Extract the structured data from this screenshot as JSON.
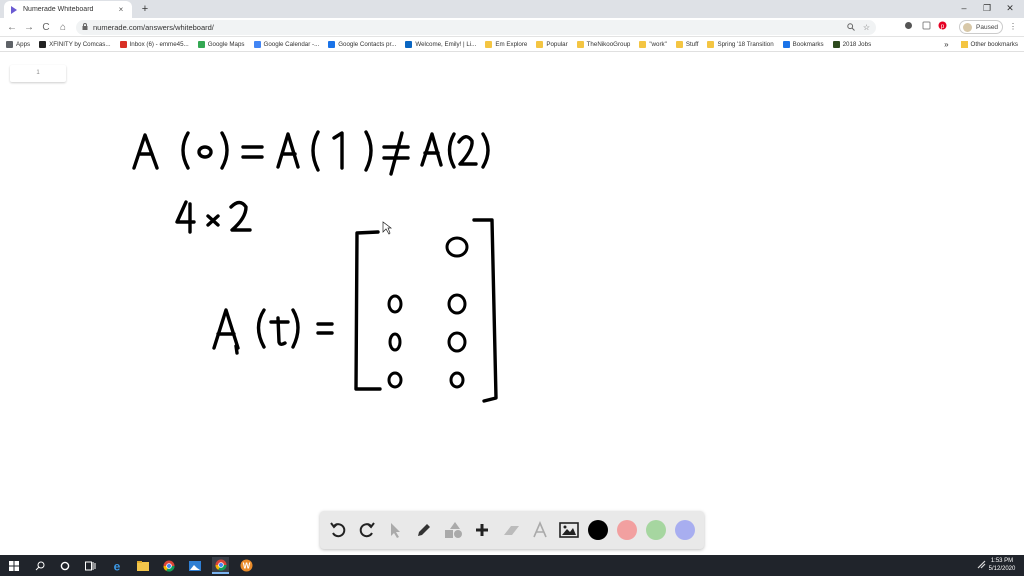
{
  "browser": {
    "tab": {
      "title": "Numerade Whiteboard",
      "close": "×"
    },
    "new_tab": "+",
    "window": {
      "minimize": "–",
      "restore": "❐",
      "close": "✕"
    },
    "nav": {
      "back": "←",
      "forward": "→",
      "reload": "C",
      "home": "⌂"
    },
    "url": "numerade.com/answers/whiteboard/",
    "profile_label": "Paused",
    "bookmarks": [
      {
        "label": "Apps",
        "color": "#5f6368"
      },
      {
        "label": "XFINITY by Comcas...",
        "color": "#222222"
      },
      {
        "label": "Inbox (6) - emme45...",
        "color": "#d93025"
      },
      {
        "label": "Google Maps",
        "color": "#34a853"
      },
      {
        "label": "Google Calendar -...",
        "color": "#4285f4"
      },
      {
        "label": "Google Contacts pr...",
        "color": "#1a73e8"
      },
      {
        "label": "Welcome, Emily! | Li...",
        "color": "#0a66c2"
      },
      {
        "label": "Em Explore",
        "color": "#f4c542"
      },
      {
        "label": "Popular",
        "color": "#f4c542"
      },
      {
        "label": "TheNikooGroup",
        "color": "#f4c542"
      },
      {
        "label": "\"work\"",
        "color": "#f4c542"
      },
      {
        "label": "Stuff",
        "color": "#f4c542"
      },
      {
        "label": "Spring '18 Transition",
        "color": "#f4c542"
      },
      {
        "label": "Bookmarks",
        "color": "#1a73e8"
      },
      {
        "label": "2018 Jobs",
        "color": "#2d4a1e"
      }
    ],
    "bookmarks_more": "»",
    "other_bookmarks": "Other bookmarks"
  },
  "whiteboard": {
    "page_indicator": "1",
    "handwriting": {
      "line1": "A (o) = A ( 1 ) ≠ A ( 2 )",
      "line2": "4 × 2",
      "line3": "A ( t ) =",
      "matrix": [
        [
          "",
          "0"
        ],
        [
          "0",
          "0"
        ],
        [
          "0",
          "0"
        ],
        [
          "0",
          "0"
        ]
      ]
    },
    "colors": {
      "black": "#000000",
      "red": "#f2a0a0",
      "green": "#a6d6a0",
      "blue": "#a8aef0"
    }
  },
  "taskbar": {
    "time": "1:53 PM",
    "date": "5/12/2020"
  }
}
